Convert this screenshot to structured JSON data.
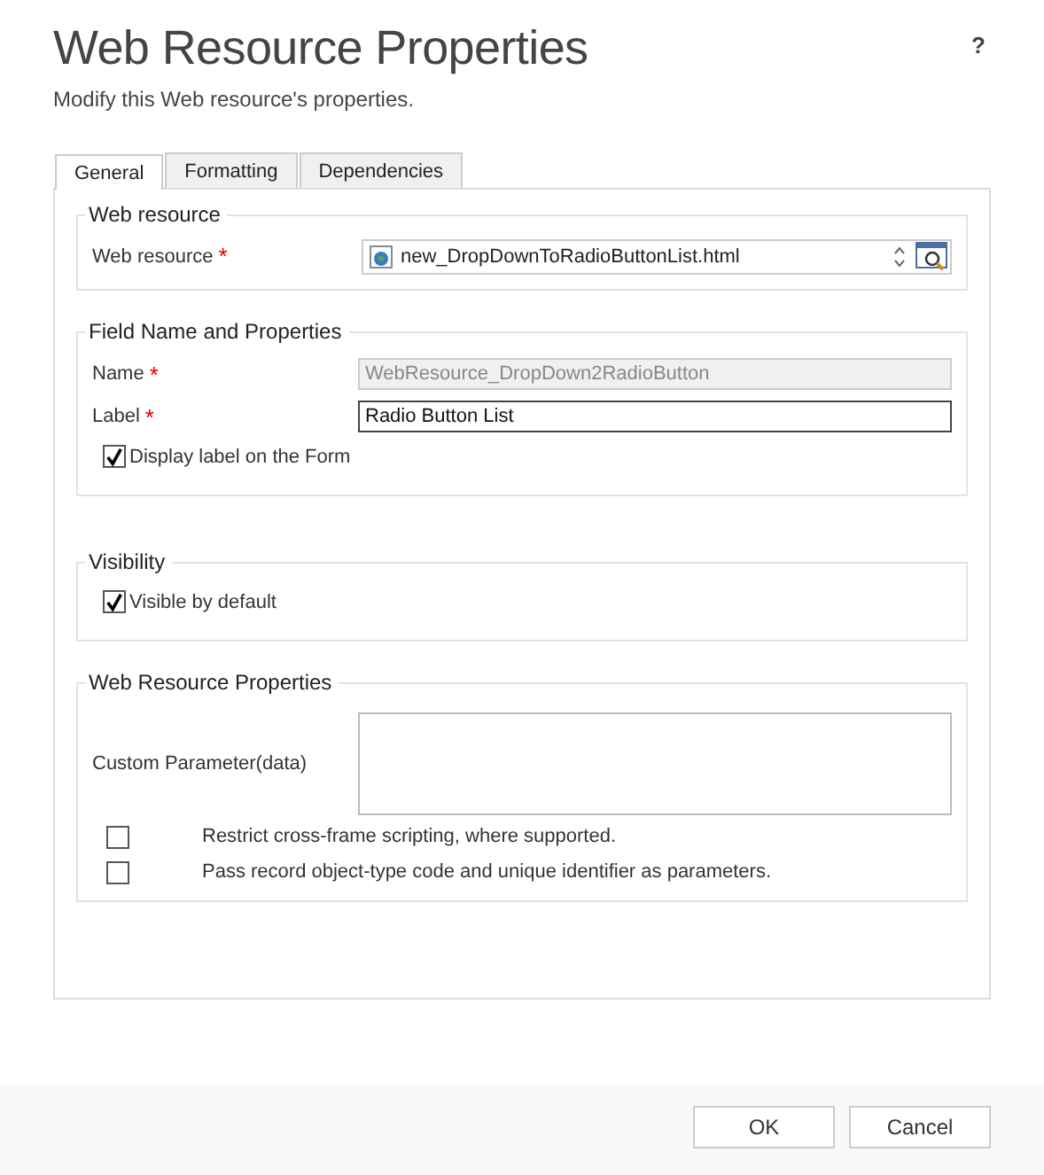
{
  "title": "Web Resource Properties",
  "help": "?",
  "subtitle": "Modify this Web resource's properties.",
  "tabs": [
    {
      "label": "General",
      "selected": true
    },
    {
      "label": "Formatting",
      "selected": false
    },
    {
      "label": "Dependencies",
      "selected": false
    }
  ],
  "web_resource": {
    "title": "Web resource",
    "label": "Web resource",
    "required_mark": "*",
    "value": "new_DropDownToRadioButtonList.html"
  },
  "field_name": {
    "title": "Field Name and Properties",
    "name": {
      "label": "Name",
      "required_mark": "*",
      "value": "WebResource_DropDown2RadioButton",
      "disabled": true
    },
    "label": {
      "label": "Label",
      "required_mark": "*",
      "value": "Radio Button List"
    },
    "display_label": {
      "label": "Display label on the Form",
      "checked": true
    }
  },
  "visibility": {
    "title": "Visibility",
    "visible": {
      "label": "Visible by default",
      "checked": true
    }
  },
  "properties": {
    "title": "Web Resource Properties",
    "custom_parameter": {
      "label": "Custom Parameter(data)"
    },
    "options": [
      {
        "label": "Restrict cross-frame scripting, where supported.",
        "checked": false
      },
      {
        "label": "Pass record object-type code and unique identifier as parameters.",
        "checked": false
      }
    ]
  },
  "buttons": [
    "OK",
    "Cancel"
  ]
}
